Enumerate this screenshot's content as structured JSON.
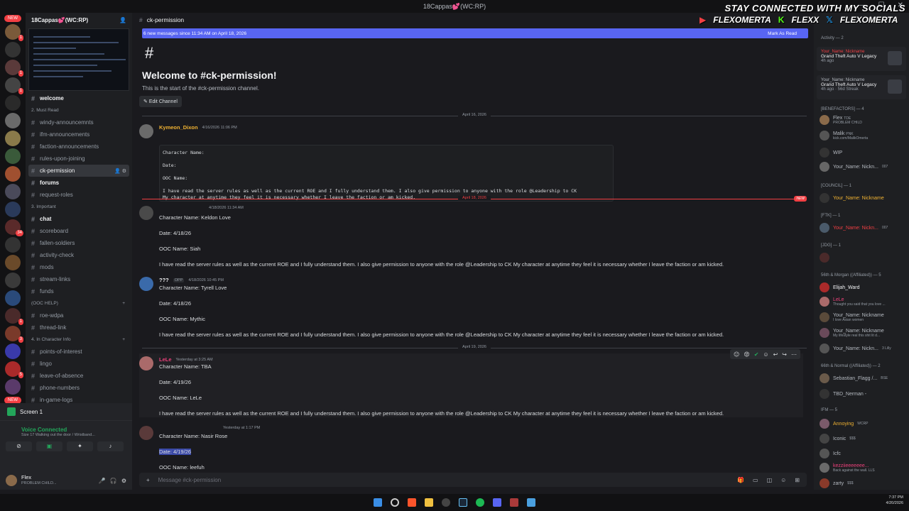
{
  "window": {
    "title": "18Cappas💕(WC:RP)"
  },
  "guild_badges": {
    "new_top": "NEW",
    "new_bottom": "NEW",
    "b1": "1",
    "b2": "1",
    "b3": "1",
    "b4": "34",
    "b5": "1",
    "b6": "3",
    "b7": "5"
  },
  "server": {
    "name": "18Cappas💕(WC:RP)"
  },
  "sidebar": {
    "welcome": "welcome",
    "cat_must_read": "2. Must Read",
    "ch1": "windy-announcemnts",
    "ch2": "ifm-announcements",
    "ch3": "faction-announcements",
    "ch4": "rules-upon-joining",
    "ch5": "ck-permission",
    "ch6": "forums",
    "ch7": "request-roles",
    "cat_important": "3. Important",
    "ch8": "chat",
    "ch9": "scoreboard",
    "ch10": "fallen-soldiers",
    "ch11": "activity-check",
    "ch12": "mods",
    "ch13": "stream-links",
    "ch14": "funds",
    "cat_ooc": "(OOC HELP)",
    "ch15": "roe-wdpa",
    "ch16": "thread-link",
    "cat_ic": "4. In Character Info",
    "ch17": "points-of-interest",
    "ch18": "lingo",
    "ch19": "leave-of-absence",
    "ch20": "phone-numbers",
    "ch21": "in-game-logs"
  },
  "screen": {
    "label": "Screen 1"
  },
  "voice": {
    "status": "Voice Connected",
    "sub": "Size 17 Walking out the door / Wristband..."
  },
  "user": {
    "name": "Flex",
    "status": "PROBLEM CHILD..."
  },
  "channel": {
    "name": "ck-permission"
  },
  "newbar": {
    "text": "6 new messages since 11:34 AM on April 18, 2026",
    "action": "Mark As Read"
  },
  "welcome": {
    "hash": "#",
    "title": "Welcome to #ck-permission!",
    "sub": "This is the start of the #ck-permission channel.",
    "edit": "Edit Channel"
  },
  "dividers": {
    "d1": "April 16, 2026",
    "d2": "April 18, 2026",
    "d3": "April 19, 2026",
    "new": "NEW"
  },
  "messages": {
    "m1": {
      "name": "Kymeon_Dixon",
      "time": "4/16/2026 11:06 PM",
      "code": [
        "Character Name:",
        "",
        "Date:",
        "",
        "OOC Name:",
        "",
        "I have read the server rules as well as the current ROE and I fully understand them. I also give permission to anyone with the role @Leadership to CK",
        "My character at anytime they feel it is necessary whether I leave the faction or am kicked."
      ]
    },
    "m2": {
      "time": "4/18/2026 11:34 AM",
      "l1": "Character Name: Keldon Love",
      "l2": "Date: 4/18/26",
      "l3": "OOC Name: Siah",
      "l4": "I have read the server rules as well as the current ROE and I fully understand them. I also give permission to anyone with the role @Leadership to CK My character at anytime they feel it is necessary whether I leave the faction or am kicked."
    },
    "m3": {
      "name": "???",
      "tag": "OPP",
      "time": "4/18/2026 10:45 PM",
      "l1": "Character Name:  Tyrell Love",
      "l2": "Date: 4/18/26",
      "l3": "OOC Name: Mythic",
      "l4": "I have read the server rules as well as the current ROE and I fully understand them. I also give permission to anyone with the role @Leadership to CK My character at anytime they feel it is necessary whether I leave the faction or am kicked."
    },
    "m4": {
      "name": "LeLe",
      "time": "Yesterday at 3:25 AM",
      "l1": "Character Name:  TBA",
      "l2": "Date: 4/19/26",
      "l3": "OOC Name: LeLe",
      "l4": "I have read the server rules as well as the current ROE and I fully understand them. I also give permission to anyone with the role @Leadership to CK My character at anytime they feel it is necessary whether I leave the faction or am kicked."
    },
    "m5": {
      "time": "Yesterday at 1:17 PM",
      "l1": "Character Name: Nasir Rose",
      "l2": "Date: 4/19/26",
      "l3": "OOC Name: leefuh"
    }
  },
  "composer": {
    "placeholder": "Message #ck-permission"
  },
  "members": {
    "activity_header": "Activity — 2",
    "a1_name": "Your_Name: Nickname",
    "a1_game": "Grand Theft Auto V Legacy",
    "a1_time": "4h ago",
    "a2_name": "Your_Name: Nickname",
    "a2_game": "Grand Theft Auto V Legacy",
    "a2_time": "4h ago · 56d Streak",
    "g_benefactors": "[BENEFACTORS] — 4",
    "b1": "Flex",
    "b1_tag": "TDE",
    "b1_sub": "PROBLEM CHILD",
    "b2": "Malik",
    "b2_tag": "PNK",
    "b2_sub": "kick.com/MalikOmerta",
    "b3": "WIP",
    "b4": "Your_Name: Nickn...",
    "b4_tag": "007",
    "g_council": "[COUNCIL] — 1",
    "c1": "Your_Name: Nickname",
    "g_ftk": "[FTK] — 1",
    "f1": "Your_Name: Nickn...",
    "f1_tag": "007",
    "g_jdg": "[JDG] — 1",
    "g_56m": "56th & Morgan ((Affiliated)) — 5",
    "m1": "Elijah_Ward",
    "m2": "LeLe",
    "m2_sub": "Thought you said that you love ...",
    "m3": "Your_Name: Nickname",
    "m3_sub": "I love Asian women",
    "m4": "Your_Name: Nickname",
    "m4_sub": "My lifestyle real this shit lit d...",
    "m5": "Your_Name: Nickn...",
    "m5_tag": "3 Lilly",
    "g_56n": "66th & Normal ((Affiliated)) — 2",
    "n1": "Sebastian_Flagg /...",
    "n1_tag": "BSE",
    "n2": "TBD_Nerman -",
    "g_ifm": "IFM — 5",
    "i1": "Annoying",
    "i1_tag": "WCRP",
    "i2": "Iconic",
    "i2_tag": "$$$",
    "i3": "Icfc",
    "i4": "kezziieeeeeee...",
    "i4_sub": "Back against the wall. LLS",
    "i5": "zarty",
    "i5_tag": "$$$"
  },
  "socials": {
    "top": "STAY CONNECTED WITH MY SOCIALS",
    "s1": "FLEXOMERTA",
    "s2": "FLEXX",
    "s3": "FLEXOMERTA"
  },
  "tray": {
    "time": "7:37 PM",
    "date": "4/20/2026"
  },
  "colors": {
    "accent": "#5865f2",
    "red": "#f23f43",
    "green": "#23a55a",
    "orange_name": "#f0b232",
    "pink_name": "#ec407a"
  }
}
